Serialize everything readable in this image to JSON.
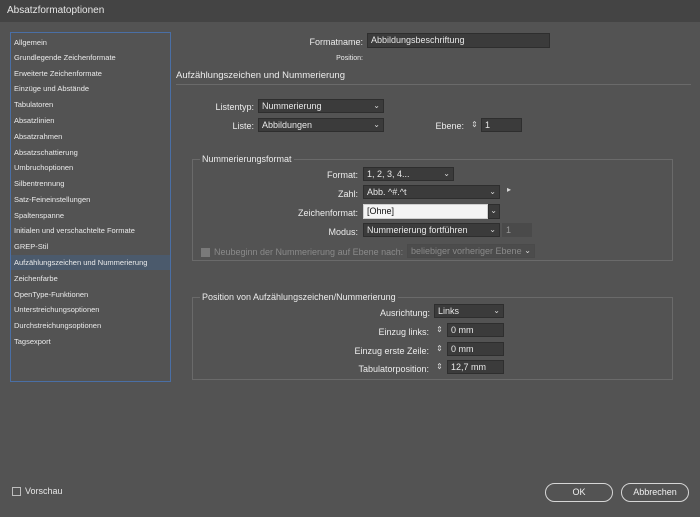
{
  "window": {
    "title": "Absatzformatoptionen"
  },
  "sidebar": {
    "items": [
      "Allgemein",
      "Grundlegende Zeichenformate",
      "Erweiterte Zeichenformate",
      "Einzüge und Abstände",
      "Tabulatoren",
      "Absatzlinien",
      "Absatzrahmen",
      "Absatzschattierung",
      "Umbruchoptionen",
      "Silbentrennung",
      "Satz-Feineinstellungen",
      "Spaltenspanne",
      "Initialen und verschachtelte Formate",
      "GREP-Stil",
      "Aufzählungszeichen und Nummerierung",
      "Zeichenfarbe",
      "OpenType-Funktionen",
      "Unterstreichungsoptionen",
      "Durchstreichungsoptionen",
      "Tagsexport"
    ],
    "selected": "Aufzählungszeichen und Nummerierung"
  },
  "header": {
    "formatname_label": "Formatname:",
    "formatname_value": "Abbildungsbeschriftung",
    "position_label": "Position:",
    "section_title": "Aufzählungszeichen und Nummerierung"
  },
  "list": {
    "listentyp_label": "Listentyp:",
    "listentyp_value": "Nummerierung",
    "liste_label": "Liste:",
    "liste_value": "Abbildungen",
    "ebene_label": "Ebene:",
    "ebene_value": "1"
  },
  "numbering": {
    "group_title": "Nummerierungsformat",
    "format_label": "Format:",
    "format_value": "1, 2, 3, 4...",
    "zahl_label": "Zahl:",
    "zahl_value": "Abb. ^#.^t",
    "zeichenformat_label": "Zeichenformat:",
    "zeichenformat_value": "[Ohne]",
    "modus_label": "Modus:",
    "modus_value": "Nummerierung fortführen",
    "modus_number": "1",
    "restart_label": "Neubeginn der Nummerierung auf Ebene nach:",
    "restart_value": "beliebiger vorheriger Ebene"
  },
  "position": {
    "group_title": "Position von Aufzählungszeichen/Nummerierung",
    "ausrichtung_label": "Ausrichtung:",
    "ausrichtung_value": "Links",
    "einzug_links_label": "Einzug links:",
    "einzug_links_value": "0 mm",
    "einzug_erste_label": "Einzug erste Zeile:",
    "einzug_erste_value": "0 mm",
    "tabulator_label": "Tabulatorposition:",
    "tabulator_value": "12,7 mm"
  },
  "footer": {
    "vorschau_label": "Vorschau",
    "ok_label": "OK",
    "cancel_label": "Abbrechen"
  },
  "icons": {
    "chevron": "⌄",
    "stepper": "⇕",
    "arrow_right": "▸"
  }
}
